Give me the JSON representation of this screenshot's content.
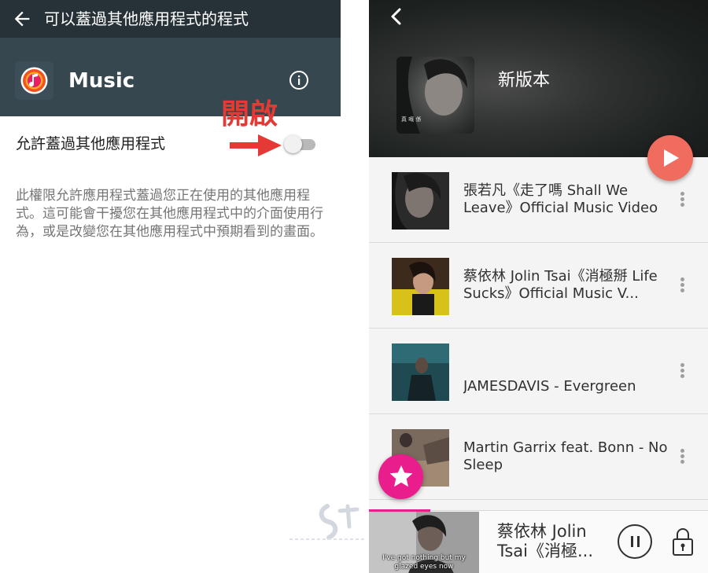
{
  "settings": {
    "title": "可以蓋過其他應用程式的程式",
    "app_name": "Music",
    "callout": "開啟",
    "permission_label": "允許蓋過其他應用程式",
    "toggle_on": false,
    "description": "此權限允許應用程式蓋過您正在使用的其他應用程式。這可能會干擾您在其他應用程式中的介面使用行為，或是改變您在其他應用程式中預期看到的畫面。"
  },
  "player": {
    "playlist_title": "新版本",
    "songs": [
      {
        "title": "張若凡《走了嗎 Shall We Leave》Official Music Video"
      },
      {
        "title": "蔡依林 Jolin Tsai《消極掰 Life Sucks》Official Music V..."
      },
      {
        "title": "JAMESDAVIS - Evergreen"
      },
      {
        "title": "Martin Garrix feat. Bonn - No Sleep"
      }
    ],
    "now_playing": {
      "title": "蔡依林 Jolin Tsai《消極...",
      "subtitle": "I've got nothing but my glazed eyes now",
      "progress": 0.18
    }
  },
  "colors": {
    "header_dark": "#263238",
    "header": "#37474f",
    "callout_red": "#e53935",
    "play_fab": "#ef6c5e",
    "star_fab": "#e91e8c"
  },
  "icons": {
    "back": "arrow-left-icon",
    "info": "info-circle-icon",
    "play": "play-icon",
    "star": "star-icon",
    "menu": "more-vertical-icon",
    "pause": "pause-icon",
    "lock": "lock-icon"
  }
}
